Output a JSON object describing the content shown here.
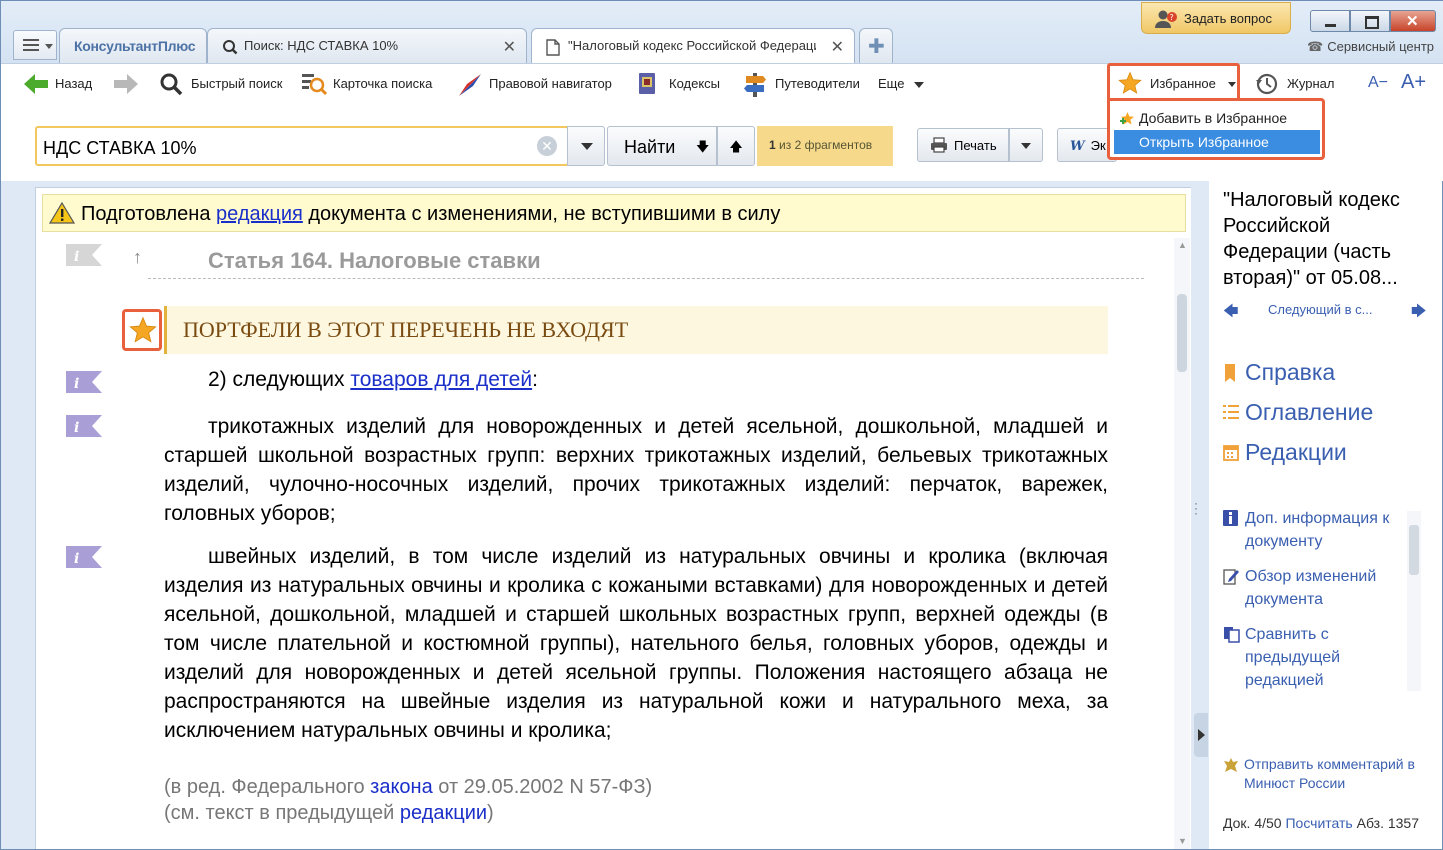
{
  "tabs": {
    "brand": "КонсультантПлюс",
    "search_tab": "Поиск: НДС СТАВКА 10%",
    "doc_tab": "\"Налоговый кодекс Российской Федерации\" (часть вторая)"
  },
  "header": {
    "ask_question": "Задать вопрос",
    "service_center": "Сервисный центр"
  },
  "toolbar": {
    "back": "Назад",
    "quick_search": "Быстрый поиск",
    "search_card": "Карточка поиска",
    "legal_navigator": "Правовой навигатор",
    "codes": "Кодексы",
    "guides": "Путеводители",
    "more": "Еще",
    "favorites": "Избранное",
    "journal": "Журнал",
    "font_smaller": "A−",
    "font_larger": "A+"
  },
  "favorites_menu": {
    "add": "Добавить в Избранное",
    "open": "Открыть Избранное"
  },
  "search": {
    "query": "НДС СТАВКА 10%",
    "find": "Найти",
    "fragments_count": "1",
    "fragments_text": "из 2 фрагментов",
    "print": "Печать",
    "word": "Эк"
  },
  "document": {
    "notice_pre": "Подготовлена ",
    "notice_link": "редакция",
    "notice_post": " документа с изменениями, не вступившими в силу",
    "article_title": "Статья 164. Налоговые ставки",
    "bookmark_note": "ПОРТФЕЛИ В ЭТОТ ПЕРЕЧЕНЬ НЕ ВХОДЯТ",
    "p1_pre": "2) следующих ",
    "p1_link": "товаров для детей",
    "p1_post": ":",
    "p2": "трикотажных изделий для новорожденных и детей ясельной, дошкольной, младшей и старшей школьной возрастных групп: верхних трикотажных изделий, бельевых трикотажных изделий, чулочно-носочных изделий, прочих трикотажных изделий: перчаток, варежек, головных уборов;",
    "p3": "швейных изделий, в том числе изделий из натуральных овчины и кролика (включая изделия из натуральных овчины и кролика с кожаными вставками) для новорожденных и детей ясельной, дошкольной, младшей и старшей школьных возрастных групп, верхней одежды (в том числе плательной и костюмной группы), нательного белья, головных уборов, одежды и изделий для новорожденных и детей ясельной группы. Положения настоящего абзаца не распространяются на швейные изделия из натуральной кожи и натурального меха, за исключением натуральных овчины и кролика;",
    "note1_pre": "(в ред. Федерального ",
    "note1_link": "закона",
    "note1_post": " от 29.05.2002 N 57-ФЗ)",
    "note2_pre": "(см. текст в предыдущей ",
    "note2_link": "редакции",
    "note2_post": ")"
  },
  "right_panel": {
    "title": "\"Налоговый кодекс Российской Федерации (часть вторая)\" от 05.08...",
    "next_label": "Следующий в с...",
    "help": "Справка",
    "contents": "Оглавление",
    "editions": "Редакции",
    "extra_info": "Доп. информация к документу",
    "changes_review": "Обзор изменений документа",
    "compare": "Сравнить с предыдущей редакцией",
    "send_comment": "Отправить комментарий в Минюст России",
    "status_doc": "Док. 4/50 ",
    "status_count": "Посчитать",
    "status_abz": " Абз. 1357"
  }
}
